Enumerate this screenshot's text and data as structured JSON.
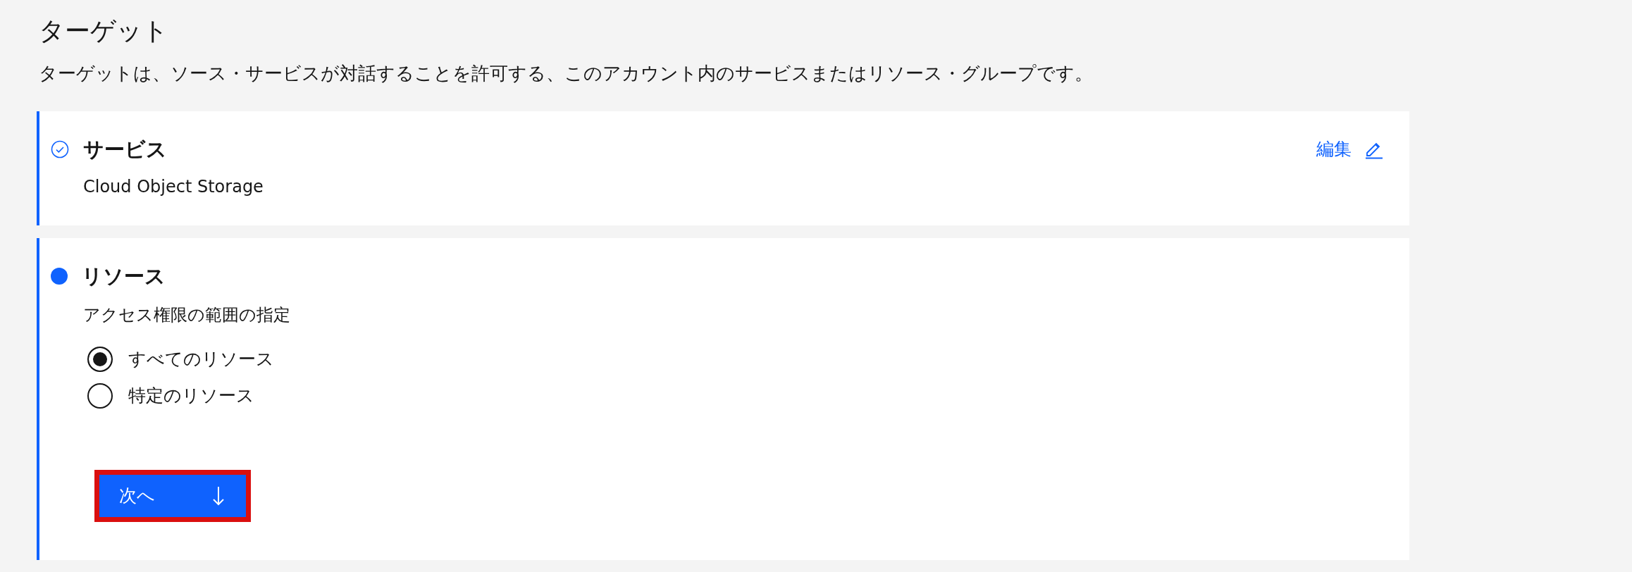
{
  "heading": "ターゲット",
  "description": "ターゲットは、ソース・サービスが対話することを許可する、このアカウント内のサービスまたはリソース・グループです。",
  "steps": [
    {
      "kind": "complete",
      "title": "サービス",
      "value": "Cloud Object Storage",
      "edit_link": "編集"
    },
    {
      "kind": "current",
      "title": "リソース",
      "subtitle": "アクセス権限の範囲の指定",
      "options": [
        {
          "label": "すべてのリソース",
          "selected": true
        },
        {
          "label": "特定のリソース",
          "selected": false
        }
      ],
      "next_button": {
        "label": "次へ",
        "highlighted": true
      }
    }
  ]
}
